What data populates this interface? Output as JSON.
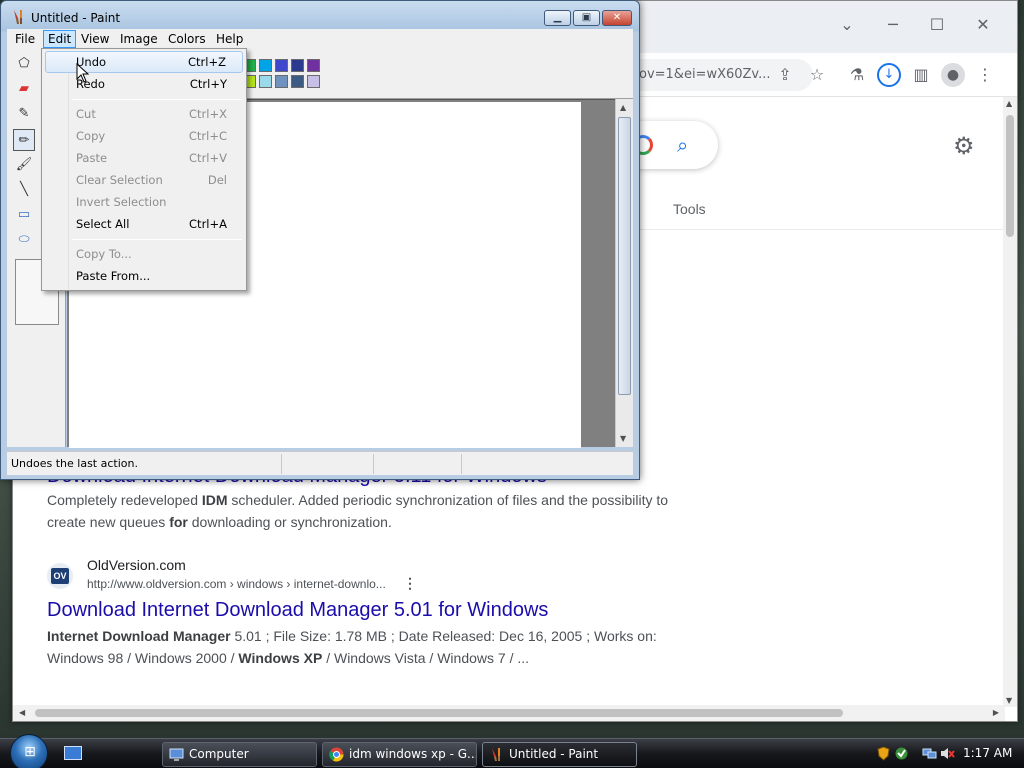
{
  "paint": {
    "title": "Untitled - Paint",
    "menu": [
      "File",
      "Edit",
      "View",
      "Image",
      "Colors",
      "Help"
    ],
    "edit_menu": [
      {
        "label": "Undo",
        "shortcut": "Ctrl+Z",
        "enabled": true,
        "highlighted": true
      },
      {
        "label": "Redo",
        "shortcut": "Ctrl+Y",
        "enabled": true
      },
      {
        "label": "Cut",
        "shortcut": "Ctrl+X",
        "enabled": false
      },
      {
        "label": "Copy",
        "shortcut": "Ctrl+C",
        "enabled": false
      },
      {
        "label": "Paste",
        "shortcut": "Ctrl+V",
        "enabled": false
      },
      {
        "label": "Clear Selection",
        "shortcut": "Del",
        "enabled": false
      },
      {
        "label": "Invert Selection",
        "shortcut": "",
        "enabled": false
      },
      {
        "label": "Select All",
        "shortcut": "Ctrl+A",
        "enabled": true
      },
      {
        "label": "Copy To...",
        "shortcut": "",
        "enabled": false
      },
      {
        "label": "Paste From...",
        "shortcut": "",
        "enabled": true
      }
    ],
    "status": "Undoes the last action.",
    "tools": [
      "free-select-icon",
      "eraser-icon",
      "color-picker-icon",
      "pencil-icon",
      "brush-icon",
      "line-icon",
      "rectangle-icon",
      "ellipse-icon"
    ],
    "selected_tool": "pencil-icon",
    "palette_row1": [
      "#22b14c",
      "#00a2e8",
      "#3f48cc",
      "#2b3a8f",
      "#7030a0"
    ],
    "palette_row2": [
      "#b5e61d",
      "#99d9ea",
      "#7092be",
      "#3c5a82",
      "#c8bfe7"
    ]
  },
  "browser": {
    "omnibox_text": "ov=1&ei=wX60Zv...",
    "tools_label": "Tools",
    "results": [
      {
        "title": "Download Internet Download Manager 5.11 for Windows",
        "snippet_html": "Completely redeveloped <b>IDM</b> scheduler. Added periodic synchronization of files and the possibility to create new queues <b>for</b> downloading or synchronization."
      },
      {
        "favicon": "OV",
        "site": "OldVersion.com",
        "url": "http://www.oldversion.com › windows › internet-downlo...",
        "title": "Download Internet Download Manager 5.01 for Windows",
        "snippet_html": "<b>Internet Download Manager</b> 5.01 ; File Size: 1.78 MB ; Date Released: Dec 16, 2005 ; Works on: Windows 98 / Windows 2000 / <b>Windows XP</b> / Windows Vista / Windows 7 / ..."
      }
    ]
  },
  "taskbar": {
    "buttons": [
      {
        "label": "Computer",
        "active": false
      },
      {
        "label": "idm windows xp - G...",
        "active": false
      },
      {
        "label": "Untitled - Paint",
        "active": true
      }
    ],
    "clock": "1:17 AM"
  },
  "colors": {
    "link": "#1a0dab",
    "accent": "#1a73e8",
    "menu_highlight": "#cce8ff"
  }
}
